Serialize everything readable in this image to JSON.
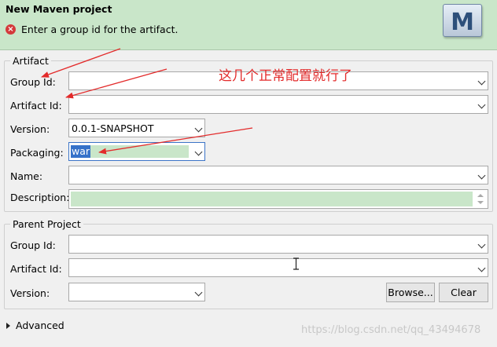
{
  "header": {
    "title": "New Maven project",
    "message": "Enter a group id for the artifact.",
    "error_icon": "error-circle-icon",
    "logo_letter": "M"
  },
  "artifact": {
    "group_title": "Artifact",
    "group_id_label": "Group Id:",
    "group_id_value": "",
    "artifact_id_label": "Artifact Id:",
    "artifact_id_value": "",
    "version_label": "Version:",
    "version_value": "0.0.1-SNAPSHOT",
    "packaging_label": "Packaging:",
    "packaging_value": "war",
    "name_label": "Name:",
    "name_value": "",
    "description_label": "Description:",
    "description_value": ""
  },
  "parent": {
    "group_title": "Parent Project",
    "group_id_label": "Group Id:",
    "group_id_value": "",
    "artifact_id_label": "Artifact Id:",
    "artifact_id_value": "",
    "version_label": "Version:",
    "version_value": "",
    "browse_label": "Browse...",
    "clear_label": "Clear"
  },
  "advanced": {
    "label": "Advanced"
  },
  "annotation": {
    "text": "这几个正常配置就行了",
    "color": "#e32b2b"
  },
  "watermark": "https://blog.csdn.net/qq_43494678",
  "colors": {
    "header_bg": "#c9e6c9",
    "selection": "#3672c9",
    "arrow": "#e32b2b"
  }
}
